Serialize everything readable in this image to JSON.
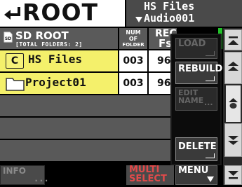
{
  "header": {
    "title": "ROOT",
    "back_icon": "back-arrow-icon",
    "project_name": "HS Files",
    "song_name": "Audio001"
  },
  "columns": {
    "name_title": "SD ROOT",
    "total_folders": "[TOTAL FOLDERS: 2]",
    "num_of_line1": "NUM",
    "num_of_line2": "OF",
    "num_of_line3": "FOLDER",
    "fs_line1": "REC",
    "fs_line2": "Fs"
  },
  "rows": [
    {
      "icon": "C",
      "name": "HS Files",
      "num_folder": "003",
      "fs": "96k"
    },
    {
      "icon": "folder-icon",
      "name": "Project01",
      "num_folder": "003",
      "fs": "96k"
    }
  ],
  "popup_menu": {
    "load": "LOAD",
    "rebuild": "REBUILD",
    "edit_name_line1": "EDIT",
    "edit_name_line2": "NAME",
    "edit_name_dots": "...",
    "delete": "DELETE"
  },
  "bottom_bar": {
    "info": "INFO",
    "info_dots": "...",
    "multi_select_line1": "MULTI",
    "multi_select_line2": "SELECT",
    "menu": "MENU"
  },
  "colors": {
    "selected_row": "#f4f06b",
    "popup_bg": "#0c0c0c",
    "multi_select_text": "#e24a4a",
    "scroll_indicator": "#22c22a"
  }
}
